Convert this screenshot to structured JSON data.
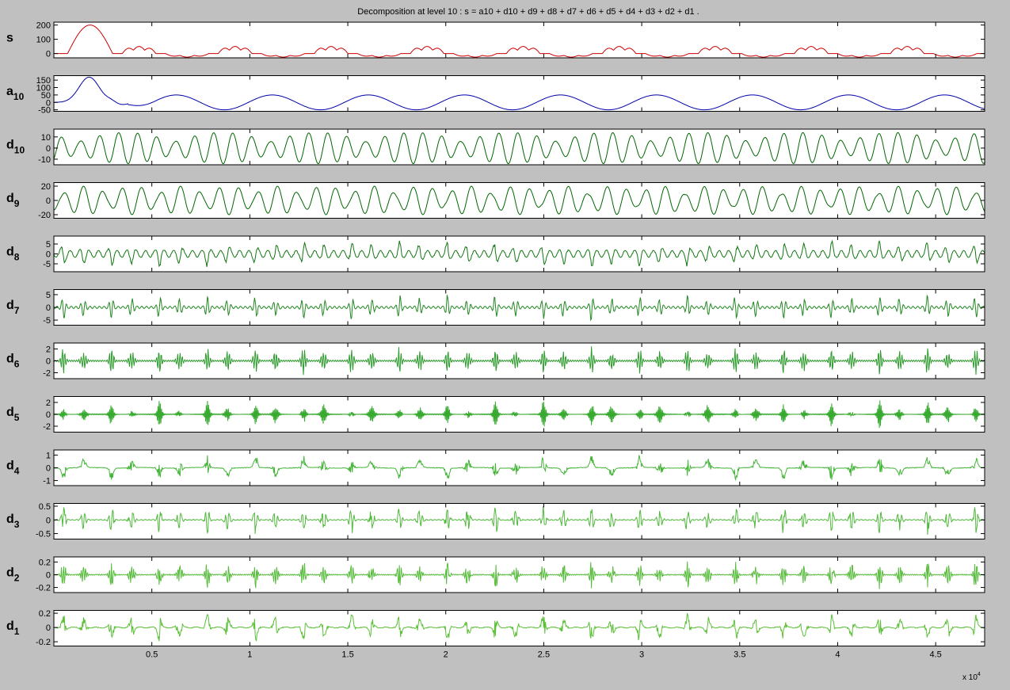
{
  "figure": {
    "title": "Decomposition at level 10 : s = a10 + d10 + d9 + d8 + d7 + d6 + d5 + d4 + d3 + d2 + d1 .",
    "x_exponent_label": "x 10",
    "x_exponent_sup": "4"
  },
  "chart_data": {
    "type": "line",
    "x_axis": {
      "range": [
        0,
        47500
      ],
      "ticks": [
        5000,
        10000,
        15000,
        20000,
        25000,
        30000,
        35000,
        40000,
        45000
      ],
      "tick_labels": [
        "0.5",
        "1",
        "1.5",
        "2",
        "2.5",
        "3",
        "3.5",
        "4",
        "4.5"
      ],
      "scale_label": "x 10^4"
    },
    "grid": false,
    "panels": [
      {
        "id": "s",
        "label": "s",
        "sub": "",
        "color": "#cc0000",
        "ylim": [
          -30,
          220
        ],
        "yticks": [
          0,
          100,
          200
        ],
        "ytick_labels": [
          "0",
          "100",
          "200"
        ],
        "signal": {
          "kind": "s",
          "peak": 200,
          "hump": 50,
          "dip": -25
        }
      },
      {
        "id": "a10",
        "label": "a",
        "sub": "10",
        "color": "#0000aa",
        "ylim": [
          -60,
          180
        ],
        "yticks": [
          -50,
          0,
          50,
          100,
          150
        ],
        "ytick_labels": [
          "-50",
          "0",
          "50",
          "100",
          "150"
        ],
        "signal": {
          "kind": "approx",
          "peak": 170,
          "amplitude": 50,
          "period": 4900
        }
      },
      {
        "id": "d10",
        "label": "d",
        "sub": "10",
        "color": "#006600",
        "ylim": [
          -15,
          17
        ],
        "yticks": [
          -10,
          0,
          10
        ],
        "ytick_labels": [
          "-10",
          "0",
          "10"
        ],
        "signal": {
          "kind": "osc",
          "amplitude": 14,
          "period": 970,
          "envelope_period": 4900
        }
      },
      {
        "id": "d9",
        "label": "d",
        "sub": "9",
        "color": "#006600",
        "ylim": [
          -25,
          25
        ],
        "yticks": [
          -20,
          0,
          20
        ],
        "ytick_labels": [
          "-20",
          "0",
          "20"
        ],
        "signal": {
          "kind": "osc",
          "amplitude": 20,
          "period": 990,
          "envelope_period": 2450
        }
      },
      {
        "id": "d8",
        "label": "d",
        "sub": "8",
        "color": "#117711",
        "ylim": [
          -9,
          9
        ],
        "yticks": [
          -5,
          0,
          5
        ],
        "ytick_labels": [
          "-5",
          "0",
          "5"
        ],
        "signal": {
          "kind": "burst",
          "amplitude": 7,
          "period": 480,
          "burst_period": 2450,
          "floor": 0.25
        }
      },
      {
        "id": "d7",
        "label": "d",
        "sub": "7",
        "color": "#228822",
        "ylim": [
          -7,
          7
        ],
        "yticks": [
          -5,
          0,
          5
        ],
        "ytick_labels": [
          "-5",
          "0",
          "5"
        ],
        "signal": {
          "kind": "burst",
          "amplitude": 5.5,
          "period": 240,
          "burst_period": 2450,
          "floor": 0.08
        }
      },
      {
        "id": "d6",
        "label": "d",
        "sub": "6",
        "color": "#2c9a2c",
        "ylim": [
          -3,
          3
        ],
        "yticks": [
          -2,
          0,
          2
        ],
        "ytick_labels": [
          "-2",
          "0",
          "2"
        ],
        "signal": {
          "kind": "burst",
          "amplitude": 2.6,
          "period": 120,
          "burst_period": 2450,
          "floor": 0.05
        }
      },
      {
        "id": "d5",
        "label": "d",
        "sub": "5",
        "color": "#38aa30",
        "ylim": [
          -3,
          3
        ],
        "yticks": [
          -2,
          0,
          2
        ],
        "ytick_labels": [
          "-2",
          "0",
          "2"
        ],
        "signal": {
          "kind": "burst",
          "amplitude": 2.4,
          "period": 60,
          "burst_period": 2450,
          "floor": 0.03
        }
      },
      {
        "id": "d4",
        "label": "d",
        "sub": "4",
        "color": "#44b438",
        "ylim": [
          -1.4,
          1.4
        ],
        "yticks": [
          -1,
          0,
          1
        ],
        "ytick_labels": [
          "-1",
          "0",
          "1"
        ],
        "signal": {
          "kind": "burst",
          "amplitude": 1.1,
          "period": 30,
          "burst_period": 2450,
          "floor": 0.03
        }
      },
      {
        "id": "d3",
        "label": "d",
        "sub": "3",
        "color": "#50b83c",
        "ylim": [
          -0.7,
          0.6
        ],
        "yticks": [
          -0.5,
          0,
          0.5
        ],
        "ytick_labels": [
          "-0.5",
          "0",
          "0.5"
        ],
        "signal": {
          "kind": "burst",
          "amplitude": 0.55,
          "period": 16,
          "burst_period": 2450,
          "floor": 0.03
        }
      },
      {
        "id": "d2",
        "label": "d",
        "sub": "2",
        "color": "#56bb3a",
        "ylim": [
          -0.28,
          0.28
        ],
        "yticks": [
          -0.2,
          0,
          0.2
        ],
        "ytick_labels": [
          "-0.2",
          "0",
          "0.2"
        ],
        "signal": {
          "kind": "burst",
          "amplitude": 0.24,
          "period": 8,
          "burst_period": 2450,
          "floor": 0.03
        }
      },
      {
        "id": "d1",
        "label": "d",
        "sub": "1",
        "color": "#5cbf38",
        "ylim": [
          -0.26,
          0.24
        ],
        "yticks": [
          -0.2,
          0,
          0.2
        ],
        "ytick_labels": [
          "-0.2",
          "0",
          "0.2"
        ],
        "signal": {
          "kind": "burst",
          "amplitude": 0.22,
          "period": 6,
          "burst_period": 2450,
          "floor": 0.03
        }
      }
    ]
  }
}
